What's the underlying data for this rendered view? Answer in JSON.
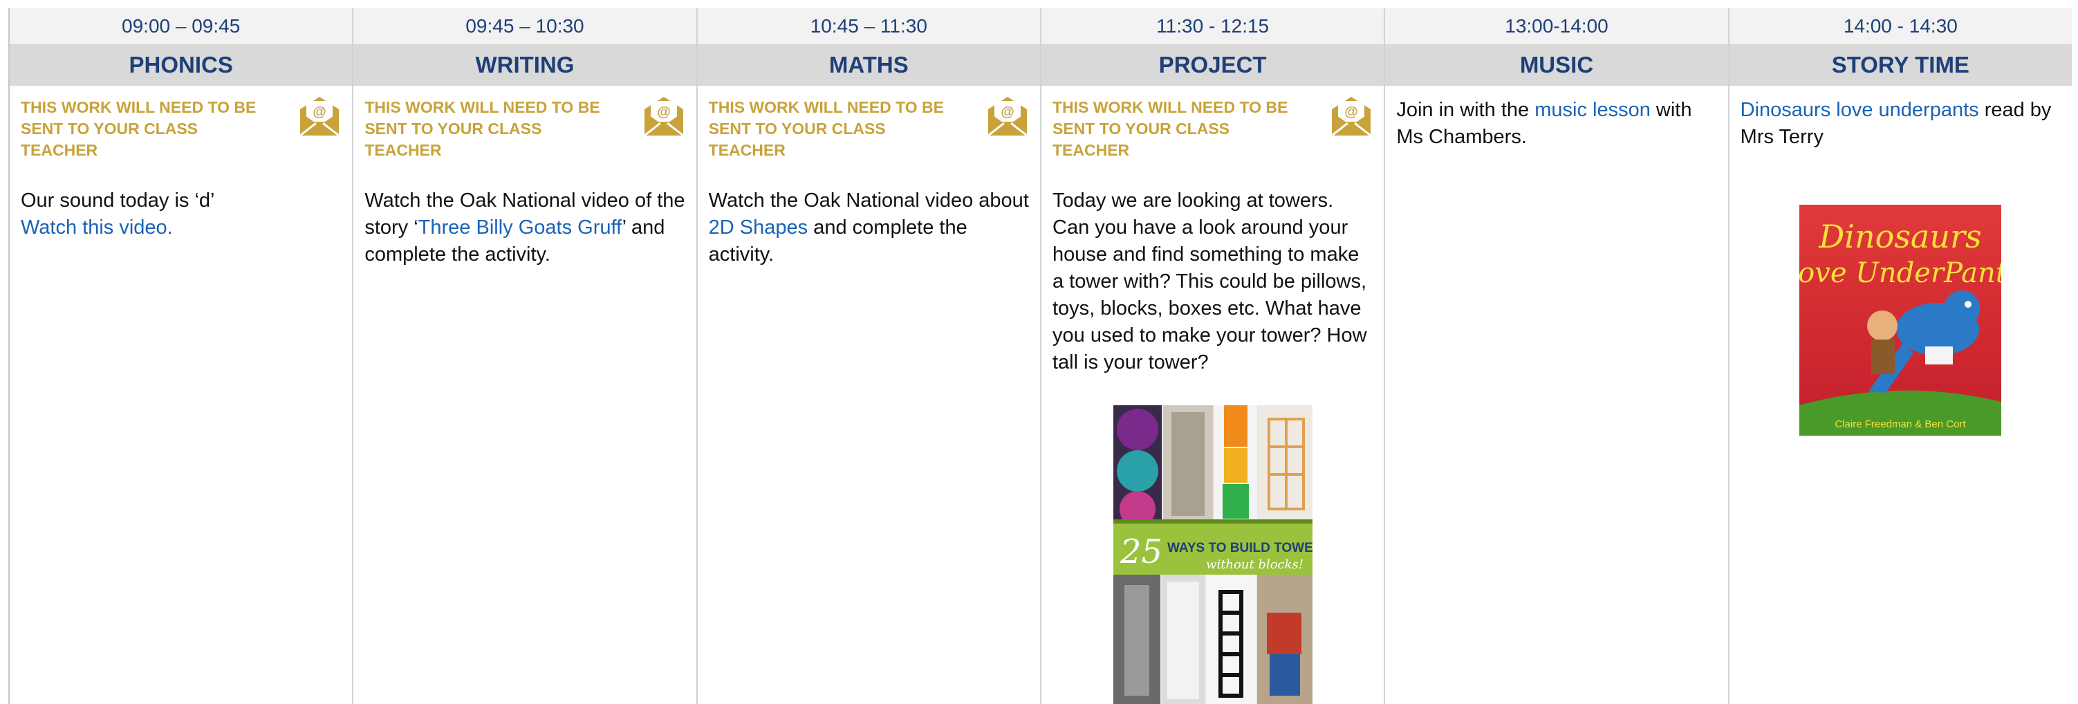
{
  "columns": [
    {
      "time": "09:00 – 09:45",
      "subject": "PHONICS",
      "notice": "THIS WORK WILL NEED TO BE SENT TO YOUR CLASS TEACHER",
      "line1": "Our sound today is ‘d’",
      "link": "Watch this video."
    },
    {
      "time": "09:45 – 10:30",
      "subject": "WRITING",
      "notice": "THIS WORK WILL NEED TO BE SENT TO YOUR CLASS TEACHER",
      "before": "Watch the Oak National video of the story ‘",
      "link": "Three Billy Goats Gruff",
      "after": "’ and complete the activity."
    },
    {
      "time": "10:45 – 11:30",
      "subject": "MATHS",
      "notice": "THIS WORK WILL NEED TO BE SENT TO YOUR CLASS TEACHER",
      "before": "Watch the Oak National video about ",
      "link": "2D Shapes",
      "after": " and complete the activity."
    },
    {
      "time": "11:30 - 12:15",
      "subject": "PROJECT",
      "notice": "THIS WORK WILL NEED TO BE SENT TO YOUR CLASS TEACHER",
      "text": "Today we are looking at towers. Can you have a look around your house and find something to make a tower with? This could be pillows, toys, blocks, boxes etc. What have you used to make your tower? How tall is your tower?",
      "image": {
        "number": "25",
        "title": "WAYS TO BUILD TOWERS",
        "subtitle": "without blocks!"
      }
    },
    {
      "time": "13:00-14:00",
      "subject": "MUSIC",
      "before": "Join in with the ",
      "link": "music lesson",
      "after": " with Ms Chambers."
    },
    {
      "time": "14:00 - 14:30",
      "subject": "STORY TIME",
      "link": "Dinosaurs love underpants",
      "after": " read by Mrs Terry",
      "book": {
        "title_line1": "Dinosaurs",
        "title_line2": "Love UnderPants",
        "authors": "Claire Freedman & Ben Cort"
      }
    }
  ],
  "colors": {
    "header_text": "#1f3f77",
    "notice": "#c9a23a",
    "link": "#1a63b5",
    "time_bg": "#f2f2f2",
    "subject_bg": "#d9d9d9"
  }
}
